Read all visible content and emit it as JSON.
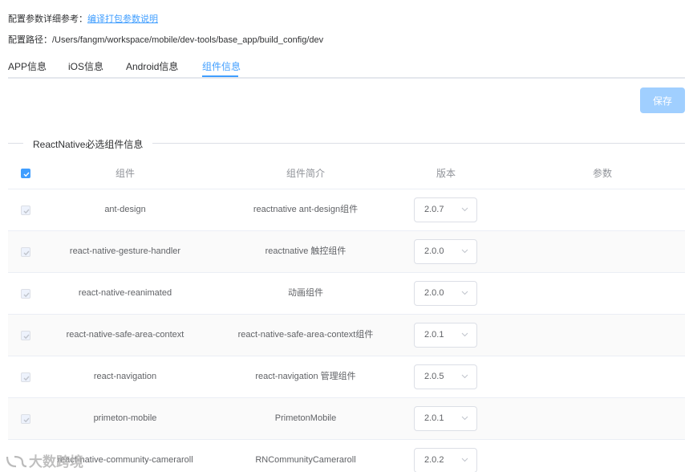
{
  "header": {
    "ref_label": "配置参数详细参考：",
    "ref_link": "编译打包参数说明",
    "path_label": "配置路径：",
    "path_value": "/Users/fangm/workspace/mobile/dev-tools/base_app/build_config/dev"
  },
  "tabs": [
    {
      "label": "APP信息",
      "active": false
    },
    {
      "label": "iOS信息",
      "active": false
    },
    {
      "label": "Android信息",
      "active": false
    },
    {
      "label": "组件信息",
      "active": true
    }
  ],
  "save_label": "保存",
  "section_title": "ReactNative必选组件信息",
  "table": {
    "columns": [
      "组件",
      "组件简介",
      "版本",
      "参数"
    ],
    "rows": [
      {
        "name": "ant-design",
        "desc": "reactnative ant-design组件",
        "version": "2.0.7"
      },
      {
        "name": "react-native-gesture-handler",
        "desc": "reactnative 触控组件",
        "version": "2.0.0"
      },
      {
        "name": "react-native-reanimated",
        "desc": "动画组件",
        "version": "2.0.0"
      },
      {
        "name": "react-native-safe-area-context",
        "desc": "react-native-safe-area-context组件",
        "version": "2.0.1"
      },
      {
        "name": "react-navigation",
        "desc": "react-navigation 管理组件",
        "version": "2.0.5"
      },
      {
        "name": "primeton-mobile",
        "desc": "PrimetonMobile",
        "version": "2.0.1"
      },
      {
        "name": "react-native-community-cameraroll",
        "desc": "RNCommunityCameraroll",
        "version": "2.0.2"
      }
    ]
  },
  "watermark": "大数跨境",
  "colors": {
    "accent": "#409eff",
    "disabled_button": "#a0cfff",
    "stripe": "#fafafa"
  }
}
